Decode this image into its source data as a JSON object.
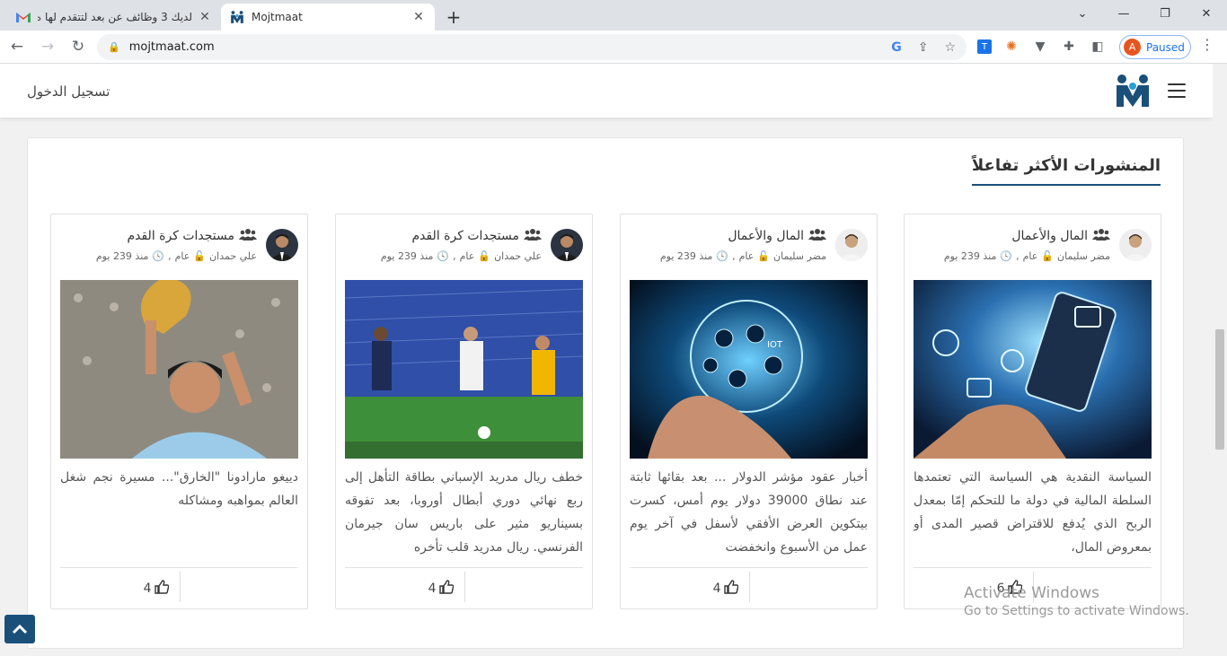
{
  "browser": {
    "tabs": [
      {
        "title": "لديك 3 وظائف عن بعد لتتقدم لها ه...",
        "favicon": "gmail-icon",
        "active": false
      },
      {
        "title": "Mojtmaat",
        "favicon": "mojtmaat-icon",
        "active": true
      }
    ],
    "new_tab": "+",
    "url": "mojtmaat.com",
    "profile_initial": "A",
    "profile_status": "Paused"
  },
  "site": {
    "login_label": "تسجيل الدخول",
    "section_title": "المنشورات الأكثر تفاعلاً",
    "accent_color": "#1a4f7a"
  },
  "posts": [
    {
      "group": "المال والأعمال",
      "author": "مضر سليمان",
      "visibility": "عام",
      "age": "منذ 239 يوم",
      "text": "السياسة النقدية هي السياسة التي تعتمدها السلطة المالية في دولة ما للتحكم إمّا بمعدل الربح الذي يُدفع للاقتراض قصير المدى أو بمعروض المال،",
      "likes": "6"
    },
    {
      "group": "المال والأعمال",
      "author": "مضر سليمان",
      "visibility": "عام",
      "age": "منذ 239 يوم",
      "text": "أخبار عقود مؤشر الدولار ... بعد بقائها ثابتة عند نطاق 39000 دولار يوم أمس، كسرت بيتكوين العرض الأفقي لأسفل في آخر يوم عمل من الأسبوع وانخفضت",
      "likes": "4"
    },
    {
      "group": "مستجدات كرة القدم",
      "author": "علي حمدان",
      "visibility": "عام",
      "age": "منذ 239 يوم",
      "text": "خطف ريال مدريد الإسباني بطاقة التأهل إلى ربع نهائي دوري أبطال أوروبا، بعد تفوقه بسيناريو مثير على باريس سان جيرمان الفرنسي. ريال مدريد قلب تأخره",
      "likes": "4"
    },
    {
      "group": "مستجدات كرة القدم",
      "author": "علي حمدان",
      "visibility": "عام",
      "age": "منذ 239 يوم",
      "text": "دييغو مارادونا \"الخارق\"... مسيرة نجم شغل العالم بمواهبه ومشاكله",
      "likes": "4"
    }
  ],
  "watermark": {
    "line1": "Activate Windows",
    "line2": "Go to Settings to activate Windows."
  }
}
